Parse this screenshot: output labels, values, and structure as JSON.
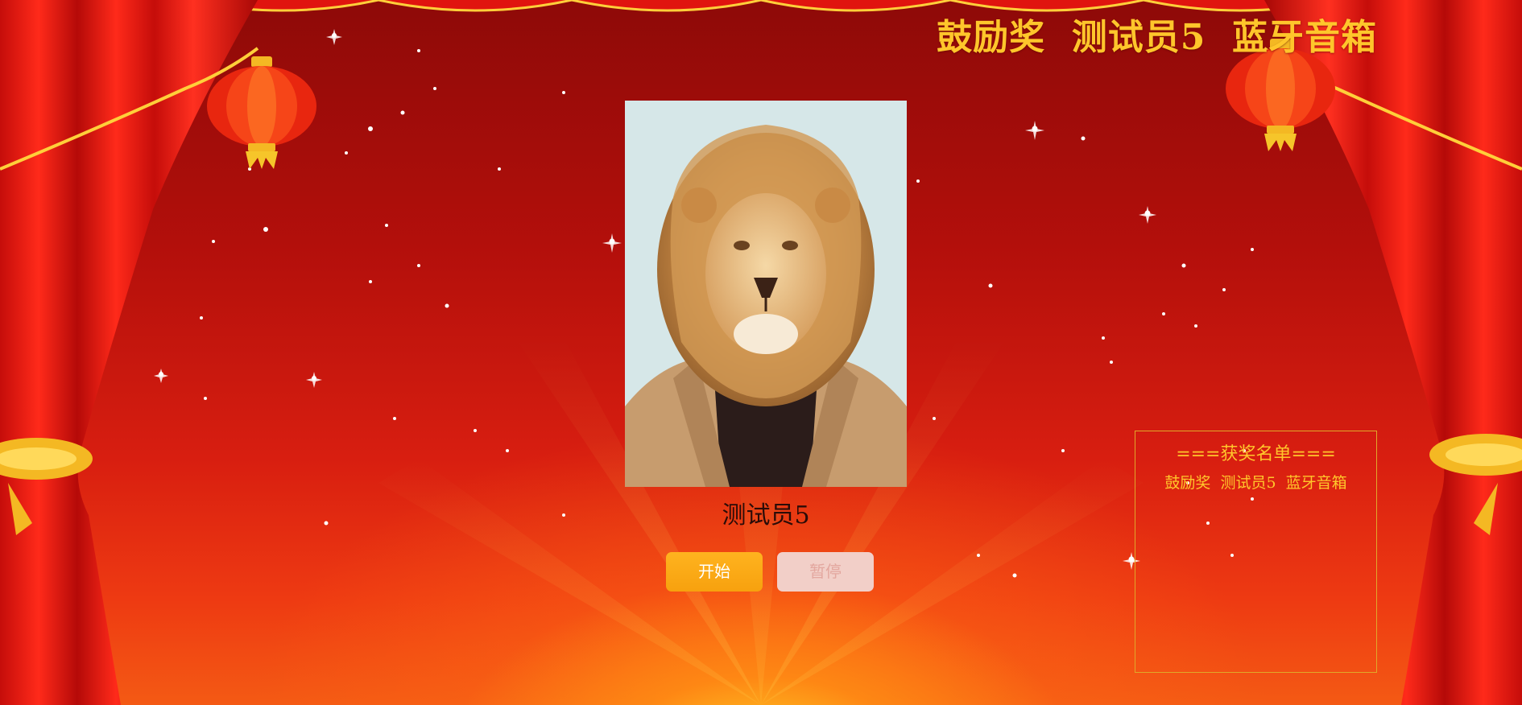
{
  "banner": {
    "text": "鼓励奖  测试员5  蓝牙音箱"
  },
  "candidate": {
    "photo_alt": "lion-in-jacket-portrait",
    "name": "测试员5"
  },
  "controls": {
    "start_label": "开始",
    "pause_label": "暂停"
  },
  "winners": {
    "title": "===获奖名单===",
    "items": [
      "鼓励奖  测试员5  蓝牙音箱"
    ]
  },
  "colors": {
    "accent_gold": "#ffc62b",
    "start_button": "#f7a10e",
    "pause_button_disabled": "#f2cfc8",
    "background_red": "#c8140d"
  },
  "icons": [
    "lantern-icon",
    "curtain-decoration"
  ]
}
